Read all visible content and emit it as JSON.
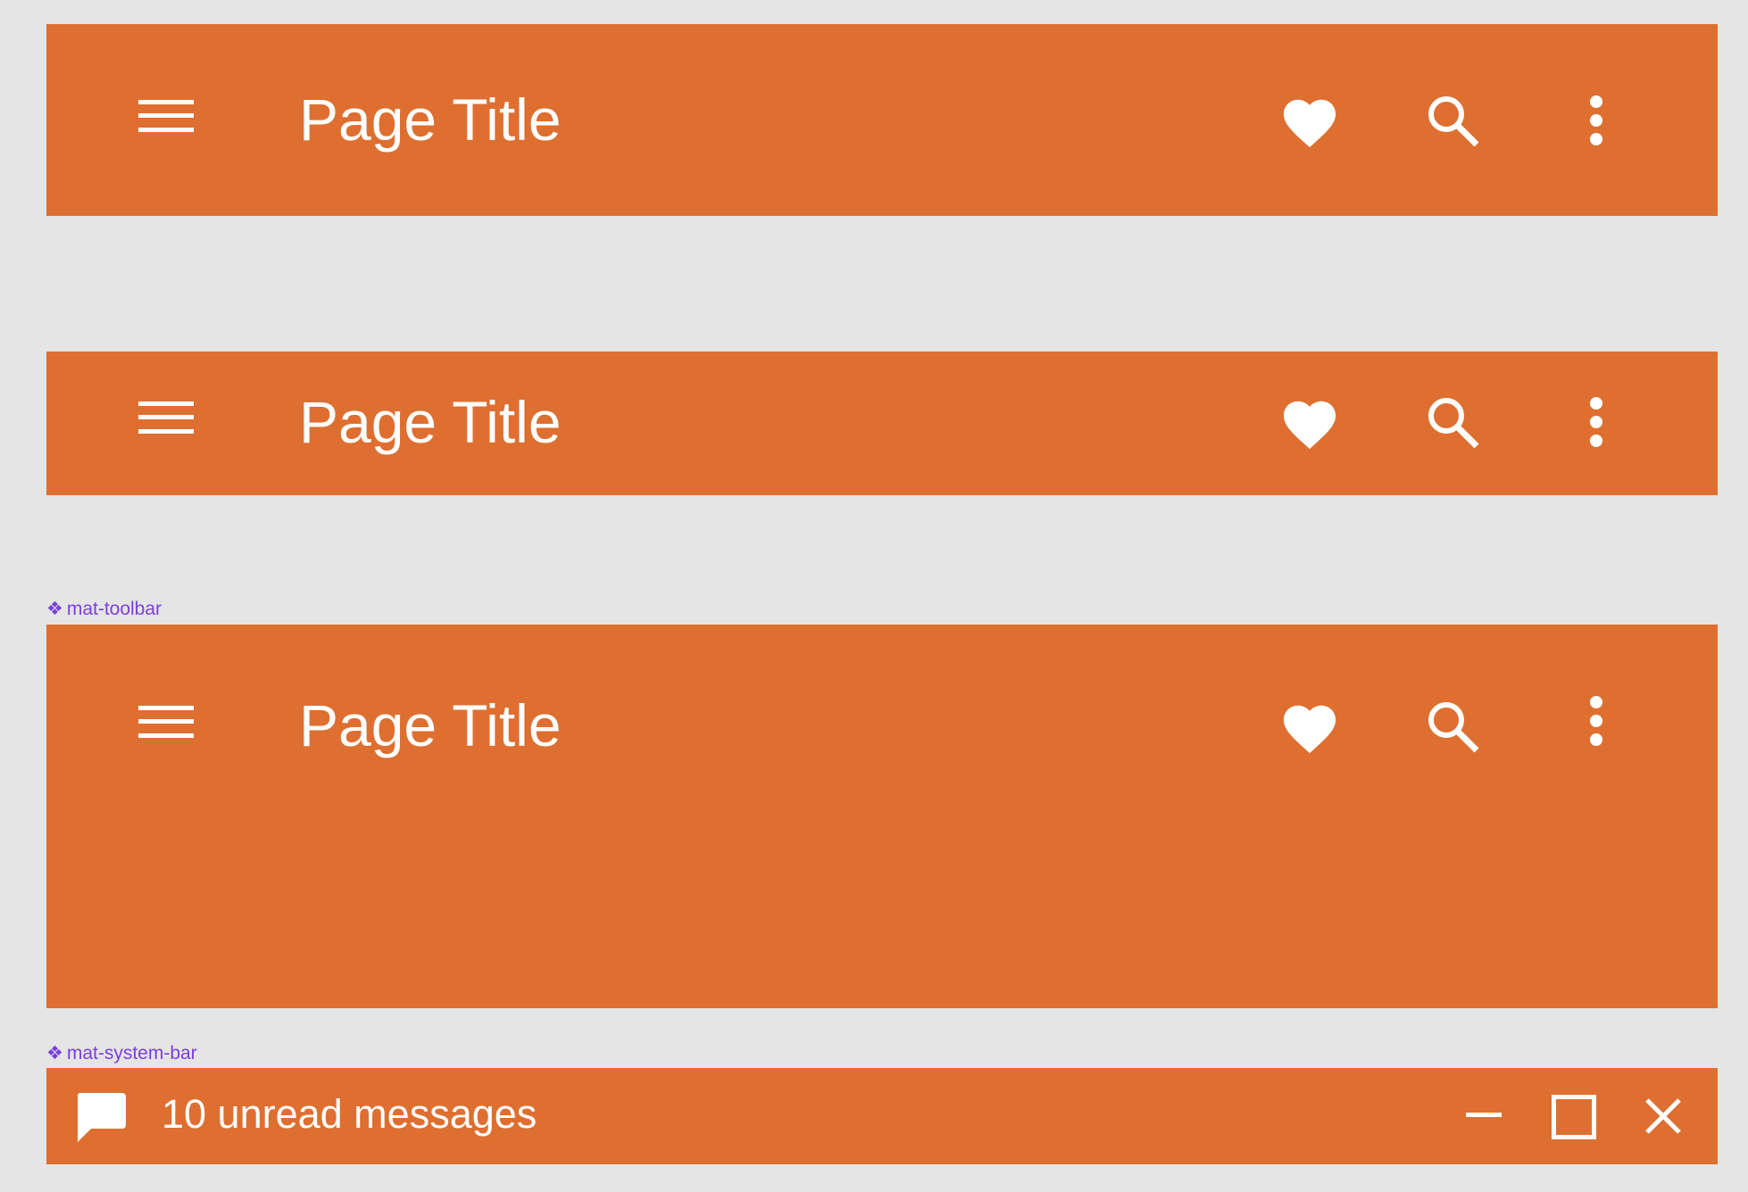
{
  "colors": {
    "background": "#e5e5e5",
    "toolbar": "#de6f30",
    "foreground": "#ffffff",
    "component_label": "#7b3fe0"
  },
  "toolbars": [
    {
      "title": "Page Title",
      "icons": [
        "menu-icon",
        "heart-icon",
        "search-icon",
        "more-vert-icon"
      ]
    },
    {
      "title": "Page Title",
      "icons": [
        "menu-icon",
        "heart-icon",
        "search-icon",
        "more-vert-icon"
      ]
    },
    {
      "component": "mat-toolbar",
      "title": "Page Title",
      "icons": [
        "menu-icon",
        "heart-icon",
        "search-icon",
        "more-vert-icon"
      ]
    }
  ],
  "system_bar": {
    "component": "mat-system-bar",
    "message": "10 unread messages",
    "icons": [
      "chat-icon",
      "minimize-icon",
      "maximize-icon",
      "close-icon"
    ]
  },
  "component_marker": "❖"
}
